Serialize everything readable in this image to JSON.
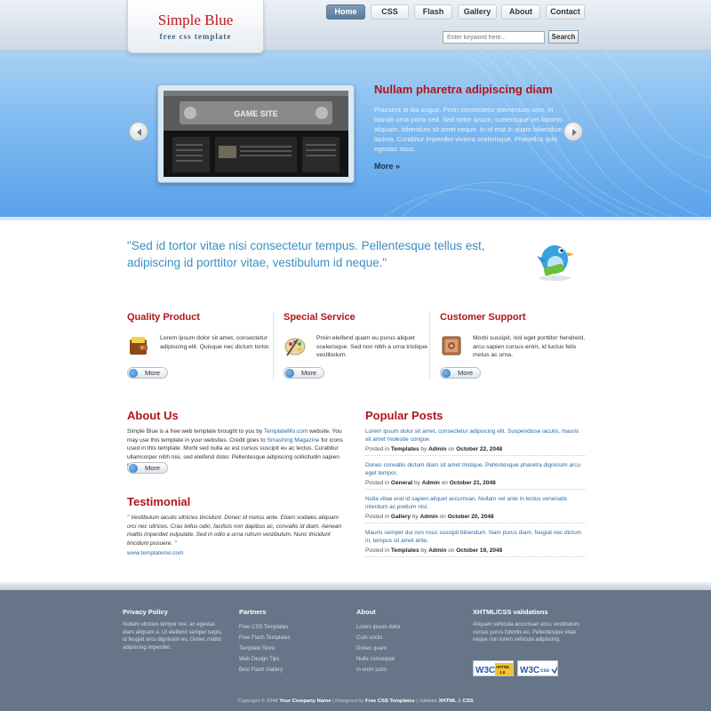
{
  "header": {
    "logo_title": "Simple Blue",
    "logo_subtitle": "free css template",
    "nav": [
      "Home",
      "CSS",
      "Flash",
      "Gallery",
      "About",
      "Contact"
    ],
    "active_nav": "Home",
    "search_placeholder": "Enter keyword here...",
    "search_button": "Search"
  },
  "slider": {
    "title": "Nullam pharetra adipiscing diam",
    "text": "Praesent at dui augue. Proin consectetur elementum sem, in blandit urna porta sed. Sed tortor ipsum, scelerisque vel lobortis aliquam, bibendum sit amet neque. In id erat in quam bibendum lacinia. Curabitur imperdiet viverra scelerisque. Phasellus quis egestas risus.",
    "more": "More »",
    "image_caption": "GAME SITE"
  },
  "quote": "\"Sed id tortor vitae nisi consectetur tempus. Pellentesque tellus est, adipiscing id porttitor vitae, vestibulum id neque.\"",
  "features": [
    {
      "title": "Quality Product",
      "text": "Lorem ipsum dolor sit amet, consectetur adipiscing elit. Quisque nec dictum tortor.",
      "more": "More",
      "icon": "wallet-icon"
    },
    {
      "title": "Special Service",
      "text": "Proin eleifend quam eu purus aliquet scelerisque. Sed non nibh a urna tristique vestibulum.",
      "more": "More",
      "icon": "palette-icon"
    },
    {
      "title": "Customer Support",
      "text": "Morbi suscipit, nisl eget porttitor hendrerit, arcu sapien cursus enim, id luctus felis metus ac urna.",
      "more": "More",
      "icon": "safe-icon"
    }
  ],
  "about": {
    "title": "About Us",
    "text_1": "Simple Blue is a free web template brought to you by ",
    "link_1": "TemplateMo.com",
    "text_2": " website. You may use this template in your websites. Credit goes to ",
    "link_2": "Smashing Magazine",
    "text_3": " for icons used in this template. Morbi sed nulla ac est cursus suscipit eu ac lectus. Curabitur ullamcorper nibh nisi, sed eleifend dolor. Pellentesque adipiscing sollicitudin sapien nec aliquet.",
    "more": "More"
  },
  "testimonial": {
    "title": "Testimonial",
    "text": "\" Vestibulum iaculis ultricies tincidunt. Donec id metus ante. Etiam sodales aliquam orci nec ultrices. Cras tellus odio, facilisis non dapibus ac, convallis id diam. Aenean mattis imperdiet vulputate. Sed in odio a urna rutrum vestibulum. Nunc tincidunt tincidunt posuere. \"",
    "link": "www.templatemo.com"
  },
  "popular": {
    "title": "Popular Posts",
    "posted_in": "Posted in",
    "by": "by",
    "on": "on",
    "posts": [
      {
        "title": "Lorem ipsum dolor sit amet, consectetur adipiscing elit. Suspendisse iaculis, mauris sit amet molestie congue.",
        "category": "Templates",
        "author": "Admin",
        "date": "October 22, 2048"
      },
      {
        "title": "Donec convallis dictum diam sit amet tristique. Pellentesque pharetra dignissim arcu eget tempor.",
        "category": "General",
        "author": "Admin",
        "date": "October 21, 2048"
      },
      {
        "title": "Nulla vitae erat id sapien aliquet accumsan. Nullam vel ante in lectus venenatis interdum ac pretium nisl.",
        "category": "Gallery",
        "author": "Admin",
        "date": "October 20, 2048"
      },
      {
        "title": "Mauris semper dui non risus suscipit bibendum. Nam purus diam, feugiat nec dictum in, tempus sit amet ante.",
        "category": "Templates",
        "author": "Admin",
        "date": "October 19, 2048"
      }
    ]
  },
  "footer": {
    "privacy": {
      "title": "Privacy Policy",
      "text": "Nullam ultricies tempor nisl, ac egestas diam aliquam a. Ut eleifend semper turpis, id feugiat arcu dignissim eu. Donec mattis adipiscing imperdiet."
    },
    "partners": {
      "title": "Partners",
      "items": [
        "Free CSS Templates",
        "Free Flash Templates",
        "Template Store",
        "Web Design Tips",
        "Best Flash Gallery"
      ]
    },
    "about": {
      "title": "About",
      "items": [
        "Lorem ipsum dolor",
        "Cum sociis",
        "Donec quam",
        "Nulla consequat",
        "In enim justo"
      ]
    },
    "validation": {
      "title": "XHTML/CSS validations",
      "text": "Aliquam vehicula accumsan arcu, vestibulum cursus purus lobortis eu. Pellentesque vitae neque non lorem vehicula adipiscing.",
      "badge_1": "W3C XHTML 1.0",
      "badge_2": "W3C CSS"
    },
    "copyright": {
      "prefix": "Copyright © 2048",
      "company": "Your Company Name",
      "designed": "| Designed by",
      "designer": "Free CSS Templates",
      "validate": "| Validate",
      "xhtml": "XHTML",
      "amp": "&",
      "css": "CSS"
    }
  },
  "colors": {
    "accent_red": "#b1151a",
    "link_blue": "#2a6aa8",
    "banner_blue": "#7fbaf0",
    "footer_bg": "#667587"
  }
}
